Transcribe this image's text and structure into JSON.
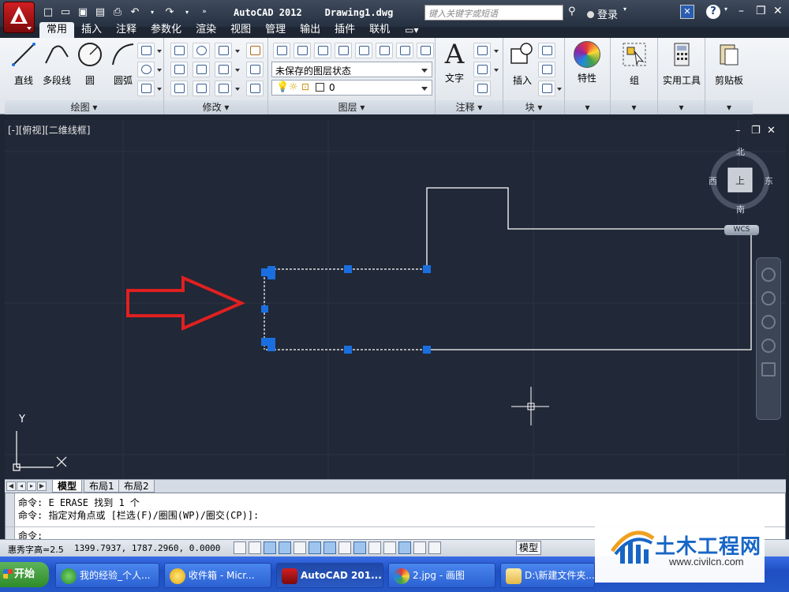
{
  "titlebar": {
    "title": "AutoCAD 2012    Drawing1.dwg",
    "search_placeholder": "键入关键字或短语",
    "login_label": "登录"
  },
  "tabs": [
    "常用",
    "插入",
    "注释",
    "参数化",
    "渲染",
    "视图",
    "管理",
    "输出",
    "插件",
    "联机"
  ],
  "ribbon": {
    "draw": {
      "title": "绘图",
      "line": "直线",
      "polyline": "多段线",
      "circle": "圆",
      "arc": "圆弧"
    },
    "modify": {
      "title": "修改"
    },
    "layers": {
      "title": "图层",
      "state": "未保存的图层状态",
      "current_layer": "0"
    },
    "annotation": {
      "title": "注释",
      "text": "文字"
    },
    "block": {
      "title": "块",
      "insert": "插入"
    },
    "properties": {
      "label": "特性"
    },
    "groups": {
      "label": "组"
    },
    "utilities": {
      "label": "实用工具"
    },
    "clipboard": {
      "label": "剪贴板"
    }
  },
  "viewport": {
    "label": "[-][俯视][二维线框]",
    "compass": {
      "north": "北",
      "south": "南",
      "east": "东",
      "west": "西",
      "top": "上"
    },
    "wcs": "WCS",
    "axis_y": "Y"
  },
  "layout_tabs": [
    "模型",
    "布局1",
    "布局2"
  ],
  "command": {
    "line1": "命令: E ERASE 找到 1 个",
    "line2": "命令: 指定对角点或 [栏选(F)/圈围(WP)/圈交(CP)]:",
    "prompt": "命令:"
  },
  "status": {
    "text_height": "惠秀字高=2.5",
    "coords": "1399.7937, 1787.2960, 0.0000",
    "model": "模型"
  },
  "taskbar": {
    "start": "开始",
    "tasks": [
      {
        "label": "我的经验_个人..."
      },
      {
        "label": "收件箱 - Micr..."
      },
      {
        "label": "AutoCAD 201..."
      },
      {
        "label": "2.jpg - 画图"
      },
      {
        "label": "D:\\新建文件夹..."
      }
    ]
  },
  "watermark": {
    "title": "土木工程网",
    "url": "www.civilcn.com"
  },
  "colors": {
    "canvas": "#212837",
    "geometry": "#ffffff",
    "grip": "#1a6fe0",
    "arrow": "#e02020",
    "ribbon": "#eef1f5"
  }
}
